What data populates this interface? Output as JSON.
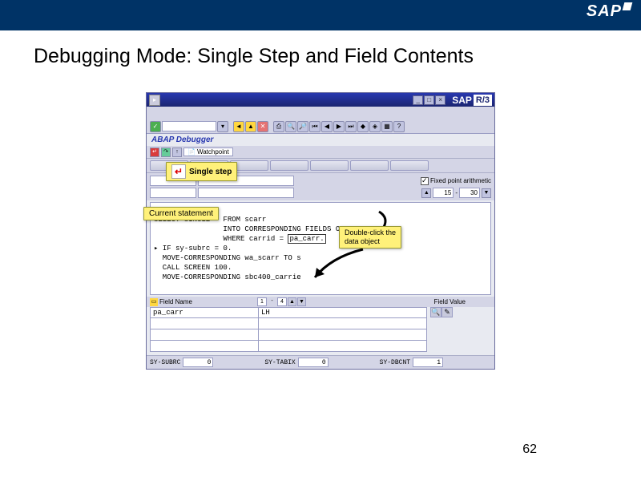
{
  "logo": "SAP",
  "slide_title": "Debugging Mode: Single Step and Field Contents",
  "page_number": "62",
  "sap_brand": "SAP",
  "sap_r3": "R/3",
  "window_subtitle": "ABAP Debugger",
  "watchpoint_label": "Watchpoint",
  "fixed_point_label": "Fixed point arithmetic",
  "line_from": "15",
  "line_to": "30",
  "code": {
    "l1": "SELECT SINGLE * FROM scarr",
    "l2": "                INTO CORRESPONDING FIELDS OF wa_scarr",
    "l3": "                WHERE carrid = ",
    "l3_hl": "pa_carr.",
    "l4": "IF sy-subrc = 0.",
    "l5": "  MOVE-CORRESPONDING wa_scarr TO s",
    "l6": "  CALL SCREEN 100.",
    "l7": "  MOVE-CORRESPONDING sbc400_carrie"
  },
  "table": {
    "field_name_label": "Field Name",
    "field_value_label": "Field Value",
    "nav_from": "1",
    "nav_to": "4",
    "rows": [
      {
        "name": "pa_carr",
        "value": "LH"
      },
      {
        "name": "",
        "value": ""
      },
      {
        "name": "",
        "value": ""
      },
      {
        "name": "",
        "value": ""
      }
    ]
  },
  "status": {
    "subrc_label": "SY-SUBRC",
    "subrc_val": "0",
    "tabix_label": "SY-TABIX",
    "tabix_val": "0",
    "dbcnt_label": "SY-DBCNT",
    "dbcnt_val": "1"
  },
  "callouts": {
    "single_step": "Single step",
    "current_stmt": "Current statement",
    "dbl_click": "Double-click the\ndata object"
  }
}
